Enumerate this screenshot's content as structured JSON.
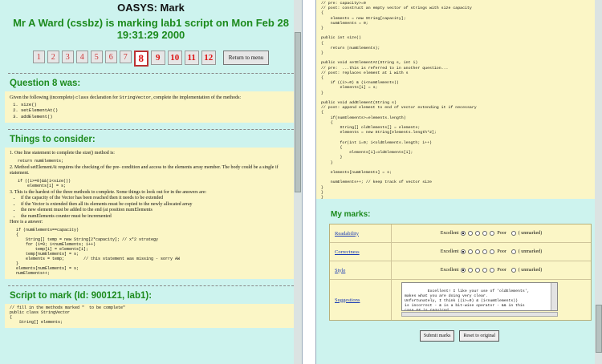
{
  "app": {
    "title": "OASYS: Mark"
  },
  "marking": {
    "line1": "Mr A Ward (cssbz) is marking lab1 script on Mon Feb 28",
    "line2": "19:31:29 2000"
  },
  "nav": {
    "questions": [
      "1",
      "2",
      "3",
      "4",
      "5",
      "6",
      "7",
      "8",
      "9",
      "10",
      "11",
      "12"
    ],
    "current": "8",
    "return_label": "Return to menu"
  },
  "question": {
    "heading": "Question 8 was:",
    "intro_a": "Given the following (incomplete)",
    "intro_code": "class",
    "intro_b": "declaration for",
    "intro_code2": "StringVector",
    "intro_c": ", complete the implementation of the methods:",
    "methods": [
      "size()",
      "setElementAt()",
      "addElement()"
    ]
  },
  "consider": {
    "heading": "Things to consider:",
    "p1": "1. One line statement to complete the size() method is:",
    "p1_code": "return numElements;",
    "p2": "2. Method setElementAt requires the checking of the pre- condition and access to the elements array member. The body could be a single if statement.",
    "p2_code": "if ((i>=0)&&(i<size())\n    elements[i] = s;",
    "p3": "3. This is the hardest of the three methods to complete. Some things to look out for in the answers are:",
    "bullets": [
      "if the capacity of the Vector has been reached then it needs to be extended",
      "if the Vector is extended then all its elements must be copied to the newly allocated array",
      "the new element must be added to the end (at position numElements",
      "the numElements counter must be incremented"
    ],
    "answer_label": "Here is a answer:",
    "answer_code": "if (numElements==capacity)\n{\n    String[] temp = new String[2*capacity]; // x*2 strategy\n    for (i=0; i<numElements; i++)\n        temp[i] = elements[i];\n    temp[numElements] = s;\n    elements = temp;        // this statement was missing - sorry AW\n}\nelements[numElements] = s;\nnumElements++;"
  },
  "script": {
    "heading": "Script to mark (Id: 900121, lab1):",
    "code_top": "// fill in the methods marked \"  to be complete\"\npublic class StringVector\n{\n    String[] elements;",
    "code_right": "// pre: capacity>=0\n// post: construct an empty vector of strings with size capacity\n{\n    elements = new String[capacity];\n    numElements = 0;\n}\n\npublic int size()\n{\n    return (numElements);\n}\n\npublic void setElementAt(String s, int i)\n// pre:  ...this is referred to in another question...\n// post: replaces element at i with s\n{\n    if ((i>=0) & (i<numElements))\n        elements[i] = s;\n}\n\npublic void addElement(String s)\n// post: append element to end of vector extending it if necessary\n{\n    if(numElements>=elements.length)\n    {\n        String[] oldElements[] = elements;\n        elements = new String[elements.length*2];\n\n        for(int i=0; i<oldElements.length; i++)\n        {\n            elements[i]=oldElements[i];\n        }\n    }\n\n    elements[numElements] = s;\n\n    numElements++; // keep track of vector size\n}\n}\n}"
  },
  "marks": {
    "heading": "My marks:",
    "scale_left": "Excellent",
    "scale_right": "Poor",
    "unmarked": "(  unmarked)",
    "rows": [
      {
        "label": "Readability",
        "selected": 0
      },
      {
        "label": "Correctness",
        "selected": 0
      },
      {
        "label": "Style",
        "selected": 0
      }
    ],
    "suggestions_label": "Suggestions",
    "suggestions_text": "Excellent! I like your use of 'oldElements',\nmakes what you are doing very clear.\nUnfortunately, I think ((i>=0) & (i<numElements))\nis incorrect - & is a bit-wise operator - && in this\ncase && is required.",
    "submit_label": "Submit marks",
    "reset_label": "Reset to original"
  }
}
